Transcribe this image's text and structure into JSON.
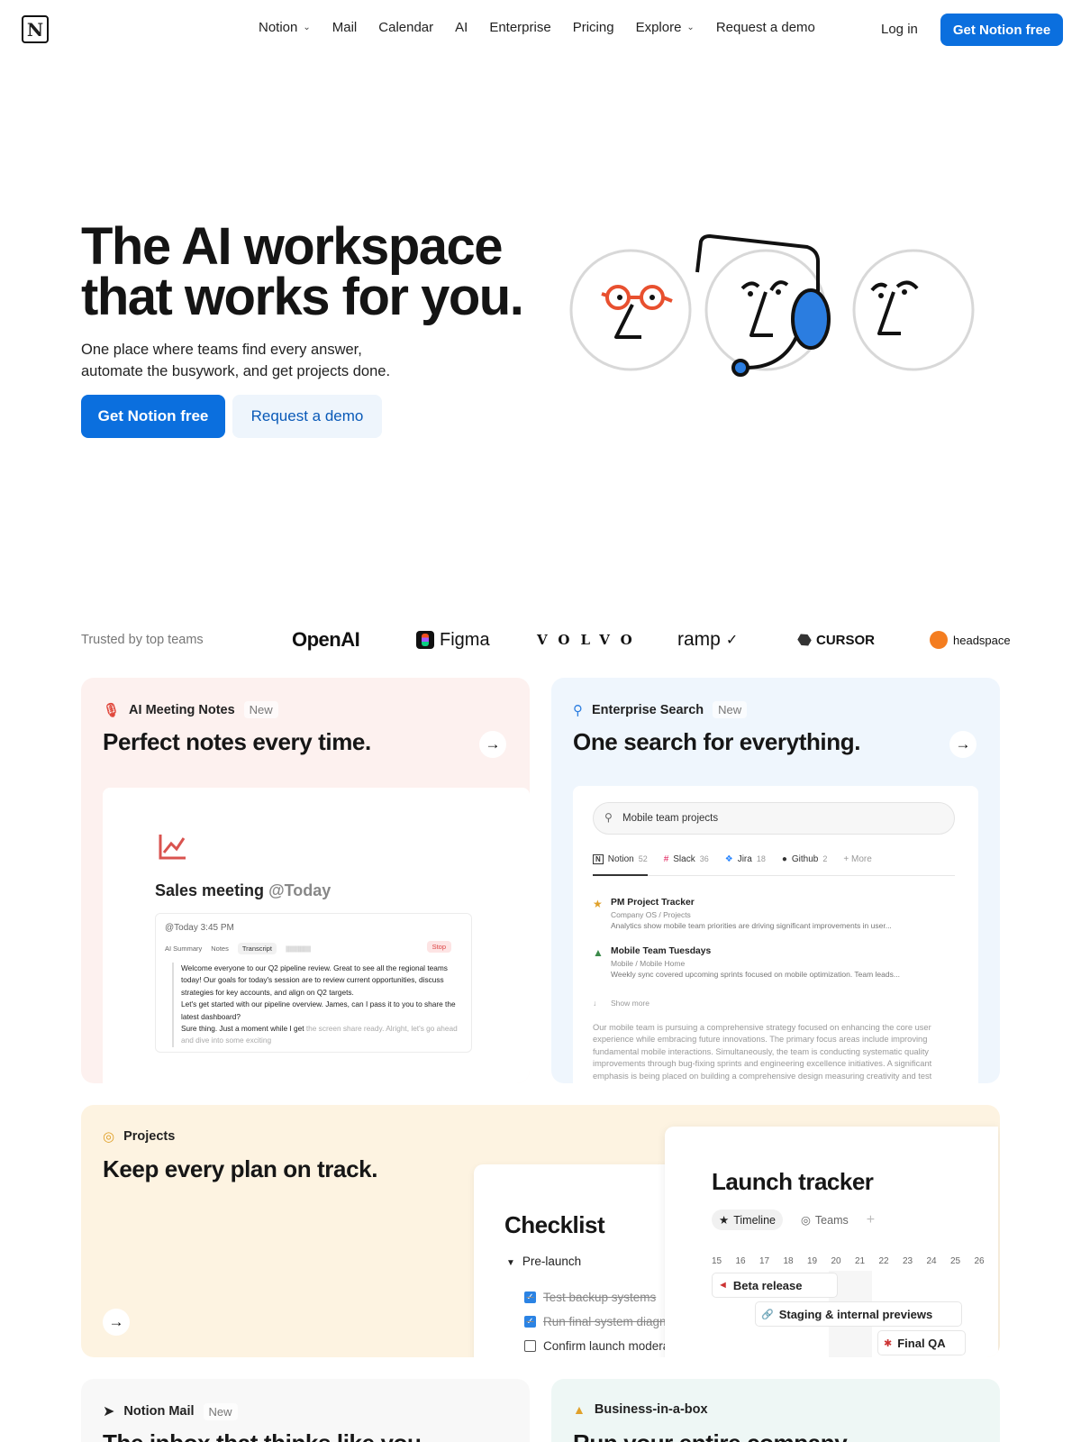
{
  "nav": {
    "links": [
      "Notion",
      "Mail",
      "Calendar",
      "AI",
      "Enterprise",
      "Pricing",
      "Explore",
      "Request a demo"
    ],
    "login": "Log in",
    "cta": "Get Notion free"
  },
  "hero": {
    "title_line1": "The AI workspace",
    "title_line2": "that works for you.",
    "subtitle_line1": "One place where teams find every answer,",
    "subtitle_line2": "automate the busywork, and get projects done.",
    "primary": "Get Notion free",
    "secondary": "Request a demo"
  },
  "trusted": {
    "label": "Trusted by top teams",
    "logos": [
      "OpenAI",
      "Figma",
      "VOLVO",
      "ramp",
      "CURSOR",
      "headspace"
    ]
  },
  "meeting": {
    "tag": "AI Meeting Notes",
    "new": "New",
    "headline": "Perfect notes every time.",
    "title": "Sales meeting",
    "title_date": "@Today",
    "meta": "@Today 3:45 PM",
    "tabs": [
      "AI Summary",
      "Notes",
      "Transcript"
    ],
    "stop": "Stop",
    "lines": [
      "Welcome everyone to our Q2 pipeline review. Great to see all the regional teams",
      "today! Our goals for today's session are to review current opportunities, discuss",
      "strategies for key accounts, and align on Q2 targets.",
      "Let's get started with our pipeline overview. James, can I pass it to you to share the",
      "latest dashboard?"
    ],
    "line_last": "Sure thing. Just a moment while I get",
    "line_fade": "the screen share ready. Alright, let's go ahead",
    "line_fade2": "and dive into some exciting"
  },
  "search": {
    "tag": "Enterprise Search",
    "new": "New",
    "headline": "One search for everything.",
    "query": "Mobile team projects",
    "tabs": [
      {
        "label": "Notion",
        "count": "52"
      },
      {
        "label": "Slack",
        "count": "36"
      },
      {
        "label": "Jira",
        "count": "18"
      },
      {
        "label": "Github",
        "count": "2"
      },
      {
        "label": "+ More",
        "count": ""
      }
    ],
    "results": [
      {
        "title": "PM Project Tracker",
        "path": "Company OS / Projects",
        "desc": "Analytics show mobile team priorities are driving significant improvements in user..."
      },
      {
        "title": "Mobile Team Tuesdays",
        "path": "Mobile / Mobile Home",
        "desc": "Weekly sync covered upcoming sprints focused on mobile optimization. Team leads..."
      }
    ],
    "show_more": "Show more",
    "paragraph": "Our mobile team is pursuing a comprehensive strategy focused on enhancing the core user experience while embracing future innovations. The primary focus areas include improving fundamental mobile interactions. Simultaneously, the team is conducting systematic quality improvements through bug-fixing sprints and engineering excellence initiatives. A significant emphasis is being placed on building a comprehensive design measuring creativity and test"
  },
  "projects": {
    "tag": "Projects",
    "headline": "Keep every plan on track.",
    "checklist_title": "Checklist",
    "section": "Pre-launch",
    "items": [
      {
        "label": "Test backup systems",
        "done": true
      },
      {
        "label": "Run final system diagnostics",
        "done": true
      },
      {
        "label": "Confirm launch moderators",
        "done": false
      }
    ],
    "tracker_title": "Launch tracker",
    "tracker_tabs": [
      "Timeline",
      "Teams"
    ],
    "days": [
      "15",
      "16",
      "17",
      "18",
      "19",
      "20",
      "21",
      "22",
      "23",
      "24",
      "25",
      "26"
    ],
    "bars": [
      "Beta release",
      "Staging & internal previews",
      "Final QA"
    ]
  },
  "mail": {
    "tag": "Notion Mail",
    "new": "New",
    "headline": "The inbox that thinks like you."
  },
  "biz": {
    "tag": "Business-in-a-box",
    "headline": "Run your entire company."
  },
  "colors": {
    "accent": "#0b6fde",
    "meeting_bg": "#fdf1ef",
    "search_bg": "#eff6fd",
    "projects_bg": "#fdf3e1",
    "mail_bg": "#f8f8f8",
    "biz_bg": "#eef7f5"
  }
}
